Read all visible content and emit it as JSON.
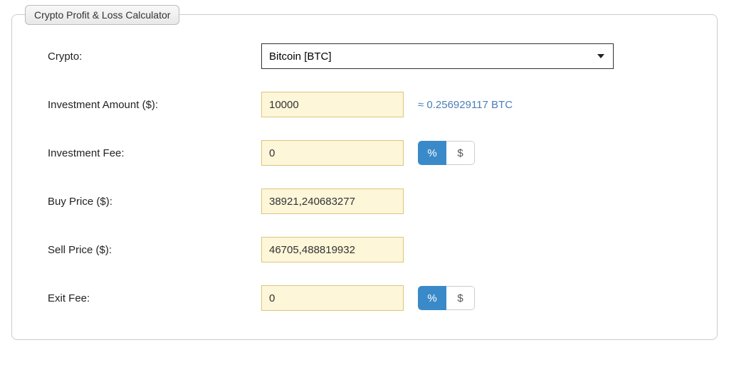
{
  "title": "Crypto Profit & Loss Calculator",
  "fields": {
    "crypto": {
      "label": "Crypto:",
      "value": "Bitcoin [BTC]"
    },
    "investment_amount": {
      "label": "Investment Amount ($):",
      "value": "10000",
      "approx": "≈ 0.256929117 BTC"
    },
    "investment_fee": {
      "label": "Investment Fee:",
      "value": "0",
      "unit_percent": "%",
      "unit_dollar": "$"
    },
    "buy_price": {
      "label": "Buy Price ($):",
      "value": "38921,240683277"
    },
    "sell_price": {
      "label": "Sell Price ($):",
      "value": "46705,488819932"
    },
    "exit_fee": {
      "label": "Exit Fee:",
      "value": "0",
      "unit_percent": "%",
      "unit_dollar": "$"
    }
  }
}
